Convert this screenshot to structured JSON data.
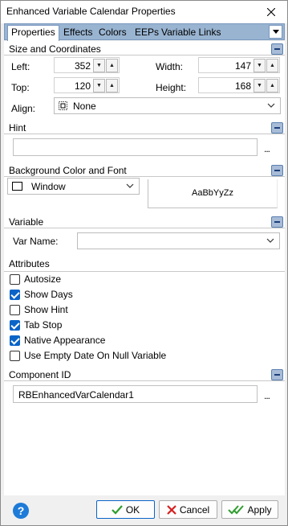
{
  "window": {
    "title": "Enhanced Variable Calendar Properties"
  },
  "tabs": [
    {
      "label": "Properties"
    },
    {
      "label": "Effects"
    },
    {
      "label": "Colors"
    },
    {
      "label": "EEPs"
    },
    {
      "label": "Variable Links"
    }
  ],
  "size_section": {
    "title": "Size and Coordinates",
    "left_label": "Left:",
    "left_value": "352",
    "top_label": "Top:",
    "top_value": "120",
    "width_label": "Width:",
    "width_value": "147",
    "height_label": "Height:",
    "height_value": "168",
    "align_label": "Align:",
    "align_value": "None"
  },
  "hint_section": {
    "title": "Hint",
    "value": "",
    "ellipsis": "..."
  },
  "background_section": {
    "title": "Background Color and Font",
    "color_value": "Window",
    "font_preview": "AaBbYyZz"
  },
  "variable_section": {
    "title": "Variable",
    "var_name_label": "Var Name:",
    "var_name_value": ""
  },
  "attributes_section": {
    "title": "Attributes",
    "items": [
      {
        "label": "Autosize",
        "checked": false
      },
      {
        "label": "Show Days",
        "checked": true
      },
      {
        "label": "Show Hint",
        "checked": false
      },
      {
        "label": "Tab Stop",
        "checked": true
      },
      {
        "label": "Native Appearance",
        "checked": true
      },
      {
        "label": "Use Empty Date On Null Variable",
        "checked": false
      }
    ]
  },
  "component_section": {
    "title": "Component ID",
    "value": "RBEnhancedVarCalendar1",
    "ellipsis": "..."
  },
  "buttons": {
    "help": "?",
    "ok": "OK",
    "cancel": "Cancel",
    "apply": "Apply"
  },
  "colors": {
    "accent": "#0a64c8",
    "tab_bar": "#99b4d1",
    "collapse": "#a8bcd8",
    "ok_check": "#2e9d2e",
    "cancel_x": "#d62020"
  }
}
